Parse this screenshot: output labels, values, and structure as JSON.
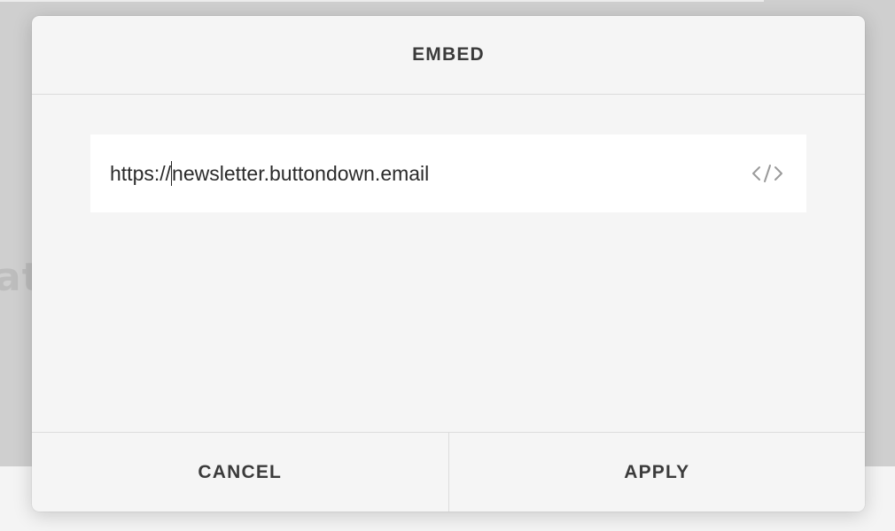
{
  "background": {
    "partial_text": "at"
  },
  "dialog": {
    "title": "EMBED",
    "url_input": {
      "value_before_caret": "https://",
      "value_after_caret": "newsletter.buttondown.email",
      "icon": "code-icon"
    },
    "buttons": {
      "cancel_label": "CANCEL",
      "apply_label": "APPLY"
    }
  },
  "colors": {
    "dialog_background": "#f5f5f5",
    "field_background": "#ffffff",
    "text": "#3b3b3b",
    "icon": "#9a9a9a"
  }
}
